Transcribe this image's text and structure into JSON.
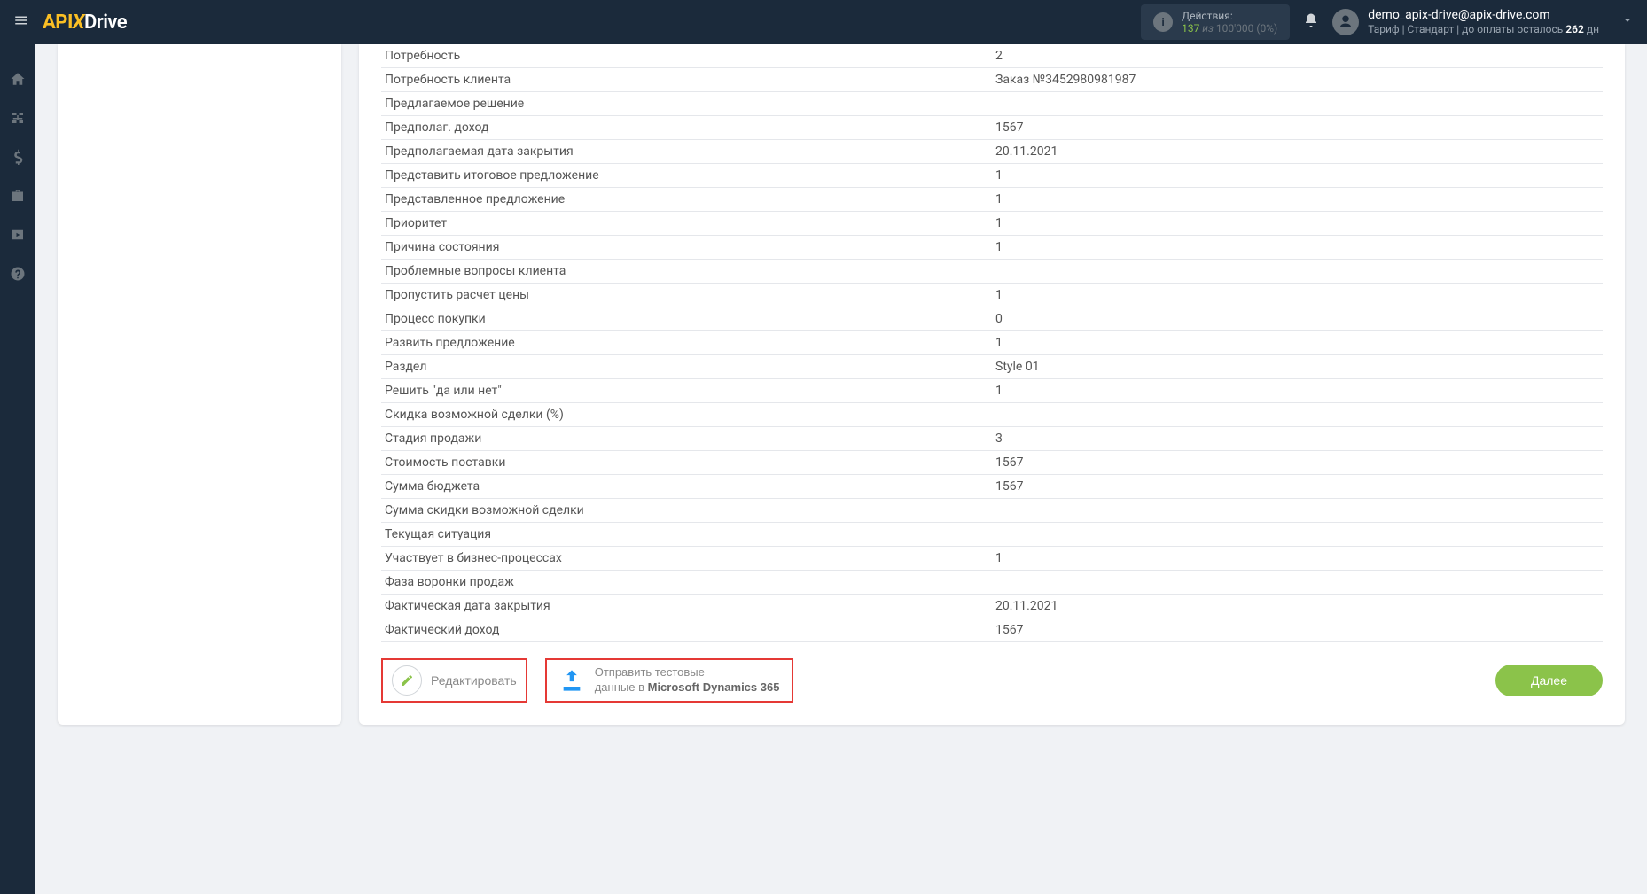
{
  "header": {
    "logo_api": "API",
    "logo_x": "X",
    "logo_drive": "Drive",
    "actions_label": "Действия:",
    "actions_count": "137",
    "actions_of": " из ",
    "actions_total": "100'000",
    "actions_pct": "(0%)",
    "user_email": "demo_apix-drive@apix-drive.com",
    "plan_prefix": "Тариф | Стандарт | до оплаты осталось ",
    "plan_days": "262",
    "plan_unit": " дн"
  },
  "rows": [
    {
      "label": "Потребность",
      "value": "2"
    },
    {
      "label": "Потребность клиента",
      "value": "Заказ №3452980981987"
    },
    {
      "label": "Предлагаемое решение",
      "value": ""
    },
    {
      "label": "Предполаг. доход",
      "value": "1567"
    },
    {
      "label": "Предполагаемая дата закрытия",
      "value": "20.11.2021"
    },
    {
      "label": "Представить итоговое предложение",
      "value": "1"
    },
    {
      "label": "Представленное предложение",
      "value": "1"
    },
    {
      "label": "Приоритет",
      "value": "1"
    },
    {
      "label": "Причина состояния",
      "value": "1"
    },
    {
      "label": "Проблемные вопросы клиента",
      "value": ""
    },
    {
      "label": "Пропустить расчет цены",
      "value": "1"
    },
    {
      "label": "Процесс покупки",
      "value": "0"
    },
    {
      "label": "Развить предложение",
      "value": "1"
    },
    {
      "label": "Раздел",
      "value": "Style 01"
    },
    {
      "label": "Решить \"да или нет\"",
      "value": "1"
    },
    {
      "label": "Скидка возможной сделки (%)",
      "value": ""
    },
    {
      "label": "Стадия продажи",
      "value": "3"
    },
    {
      "label": "Стоимость поставки",
      "value": "1567"
    },
    {
      "label": "Сумма бюджета",
      "value": "1567"
    },
    {
      "label": "Сумма скидки возможной сделки",
      "value": ""
    },
    {
      "label": "Текущая ситуация",
      "value": ""
    },
    {
      "label": "Участвует в бизнес-процессах",
      "value": "1"
    },
    {
      "label": "Фаза воронки продаж",
      "value": ""
    },
    {
      "label": "Фактическая дата закрытия",
      "value": "20.11.2021"
    },
    {
      "label": "Фактический доход",
      "value": "1567"
    }
  ],
  "buttons": {
    "edit": "Редактировать",
    "send_line1": "Отправить тестовые",
    "send_line2_pre": "данные в ",
    "send_line2_bold": "Microsoft Dynamics 365",
    "next": "Далее"
  }
}
